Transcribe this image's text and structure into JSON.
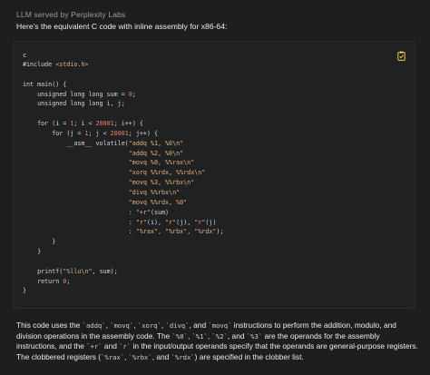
{
  "header": {
    "title": "LLM served by Perplexity Labs"
  },
  "intro": {
    "text": "Here's the equivalent C code with inline assembly for x86-64:"
  },
  "codeblock": {
    "language": "c",
    "copy_icon": "clipboard-check-icon",
    "lines": [
      [
        {
          "t": "#include ",
          "c": "kw"
        },
        {
          "t": "<stdio.h>",
          "c": "inc"
        }
      ],
      [],
      [
        {
          "t": "int main() {",
          "c": "kw"
        }
      ],
      [
        {
          "t": "    unsigned long long sum = ",
          "c": "kw"
        },
        {
          "t": "0",
          "c": "num"
        },
        {
          "t": ";",
          "c": "kw"
        }
      ],
      [
        {
          "t": "    unsigned long long i, j;",
          "c": "kw"
        }
      ],
      [],
      [
        {
          "t": "    for (i = ",
          "c": "kw"
        },
        {
          "t": "1",
          "c": "num"
        },
        {
          "t": "; i < ",
          "c": "kw"
        },
        {
          "t": "20001",
          "c": "num"
        },
        {
          "t": "; i++) {",
          "c": "kw"
        }
      ],
      [
        {
          "t": "        for (j = ",
          "c": "kw"
        },
        {
          "t": "1",
          "c": "num"
        },
        {
          "t": "; j < ",
          "c": "kw"
        },
        {
          "t": "20001",
          "c": "num"
        },
        {
          "t": "; j++) {",
          "c": "kw"
        }
      ],
      [
        {
          "t": "            __asm__ volatile(",
          "c": "kw"
        },
        {
          "t": "\"addq %1, %0\\n\"",
          "c": "str"
        }
      ],
      [
        {
          "t": "                             ",
          "c": "kw"
        },
        {
          "t": "\"addq %2, %0\\n\"",
          "c": "str"
        }
      ],
      [
        {
          "t": "                             ",
          "c": "kw"
        },
        {
          "t": "\"movq %0, %%rax\\n\"",
          "c": "str"
        }
      ],
      [
        {
          "t": "                             ",
          "c": "kw"
        },
        {
          "t": "\"xorq %%rdx, %%rdx\\n\"",
          "c": "str"
        }
      ],
      [
        {
          "t": "                             ",
          "c": "kw"
        },
        {
          "t": "\"movq %3, %%rbx\\n\"",
          "c": "str"
        }
      ],
      [
        {
          "t": "                             ",
          "c": "kw"
        },
        {
          "t": "\"divq %%rbx\\n\"",
          "c": "str"
        }
      ],
      [
        {
          "t": "                             ",
          "c": "kw"
        },
        {
          "t": "\"movq %%rdx, %0\"",
          "c": "str"
        }
      ],
      [
        {
          "t": "                             : ",
          "c": "kw"
        },
        {
          "t": "\"+r\"",
          "c": "str"
        },
        {
          "t": "(sum)",
          "c": "kw"
        }
      ],
      [
        {
          "t": "                             : ",
          "c": "kw"
        },
        {
          "t": "\"r\"",
          "c": "str"
        },
        {
          "t": "(i), ",
          "c": "kw"
        },
        {
          "t": "\"r\"",
          "c": "str"
        },
        {
          "t": "(j), ",
          "c": "kw"
        },
        {
          "t": "\"r\"",
          "c": "str"
        },
        {
          "t": "(j)",
          "c": "kw"
        }
      ],
      [
        {
          "t": "                             : ",
          "c": "kw"
        },
        {
          "t": "\"%rax\", \"%rbx\", \"%rdx\"",
          "c": "str"
        },
        {
          "t": ");",
          "c": "kw"
        }
      ],
      [
        {
          "t": "        }",
          "c": "kw"
        }
      ],
      [
        {
          "t": "    }",
          "c": "kw"
        }
      ],
      [],
      [
        {
          "t": "    printf(",
          "c": "kw"
        },
        {
          "t": "\"%llu\\n\"",
          "c": "str"
        },
        {
          "t": ", sum);",
          "c": "kw"
        }
      ],
      [
        {
          "t": "    return ",
          "c": "kw"
        },
        {
          "t": "0",
          "c": "num"
        },
        {
          "t": ";",
          "c": "kw"
        }
      ],
      [
        {
          "t": "}",
          "c": "kw"
        }
      ]
    ]
  },
  "outro": {
    "parts": [
      {
        "t": "This code uses the "
      },
      {
        "t": "`addq`",
        "code": true
      },
      {
        "t": ", "
      },
      {
        "t": "`movq`",
        "code": true
      },
      {
        "t": ", "
      },
      {
        "t": "`xorq`",
        "code": true
      },
      {
        "t": ", "
      },
      {
        "t": "`divq`",
        "code": true
      },
      {
        "t": ", and "
      },
      {
        "t": "`movq`",
        "code": true
      },
      {
        "t": " instructions to perform the addition, modulo, and division operations in the assembly code. The "
      },
      {
        "t": "`%0`",
        "code": true
      },
      {
        "t": ", "
      },
      {
        "t": "`%1`",
        "code": true
      },
      {
        "t": ", "
      },
      {
        "t": "`%2`",
        "code": true
      },
      {
        "t": ", and "
      },
      {
        "t": "`%3`",
        "code": true
      },
      {
        "t": " are the operands for the assembly instructions, and the "
      },
      {
        "t": "`+r`",
        "code": true
      },
      {
        "t": " and "
      },
      {
        "t": "`r`",
        "code": true
      },
      {
        "t": " in the input/output operands specify that the operands are general-purpose registers. The clobbered registers ("
      },
      {
        "t": "`%rax`",
        "code": true
      },
      {
        "t": ", "
      },
      {
        "t": "`%rbx`",
        "code": true
      },
      {
        "t": ", and "
      },
      {
        "t": "`%rdx`",
        "code": true
      },
      {
        "t": ") are specified in the clobber list."
      }
    ]
  }
}
